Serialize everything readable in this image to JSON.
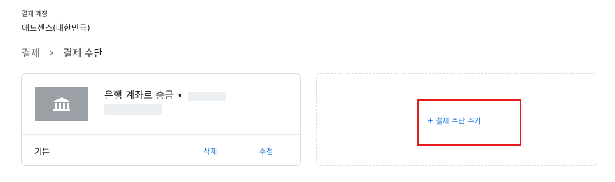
{
  "account": {
    "label": "결제 계정",
    "name": "애드센스(대한민국)"
  },
  "breadcrumb": {
    "root": "결제",
    "separator": "›",
    "current": "결제 수단"
  },
  "payment_card": {
    "title": "은행 계좌로 송금 •",
    "icon": "bank-icon",
    "status": "기본",
    "delete_label": "삭제",
    "edit_label": "수정"
  },
  "add_card": {
    "label": "+ 결제 수단 추가"
  },
  "colors": {
    "link": "#1a73e8",
    "highlight": "#e31b1b",
    "thumb": "#9aa0a6"
  }
}
